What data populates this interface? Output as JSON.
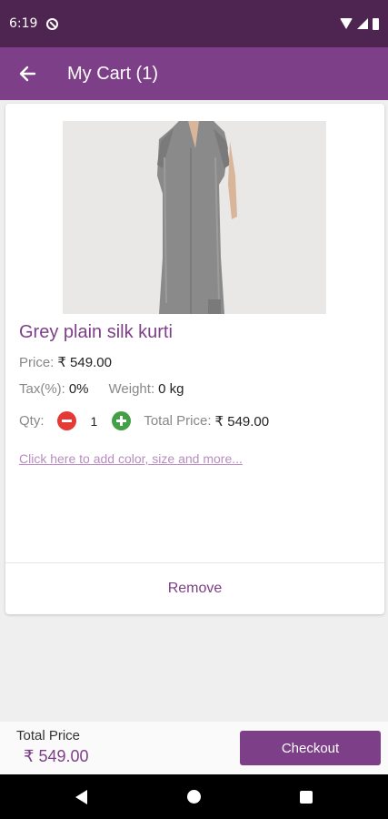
{
  "status_bar": {
    "time": "6:19"
  },
  "app_bar": {
    "title": "My Cart (1)"
  },
  "product": {
    "name": "Grey plain silk kurti",
    "price_label": "Price:",
    "price_value": "₹ 549.00",
    "tax_label": "Tax(%):",
    "tax_value": "0%",
    "weight_label": "Weight:",
    "weight_value": "0 kg",
    "qty_label": "Qty:",
    "qty_value": "1",
    "total_label": "Total Price:",
    "total_value": "₹ 549.00",
    "more_link": "Click here to add color, size and more...",
    "remove_label": "Remove"
  },
  "bottom_bar": {
    "total_title": "Total Price",
    "total_amount": "₹ 549.00",
    "checkout_label": "Checkout"
  },
  "colors": {
    "status_bar": "#4e2450",
    "app_bar": "#7d3f87",
    "accent": "#7d3f87",
    "minus": "#e53935",
    "plus": "#43a047"
  },
  "icons": [
    "dnd-icon",
    "wifi-icon",
    "signal-icon",
    "battery-icon",
    "back-arrow-icon",
    "nav-back-icon",
    "nav-home-icon",
    "nav-recents-icon"
  ]
}
